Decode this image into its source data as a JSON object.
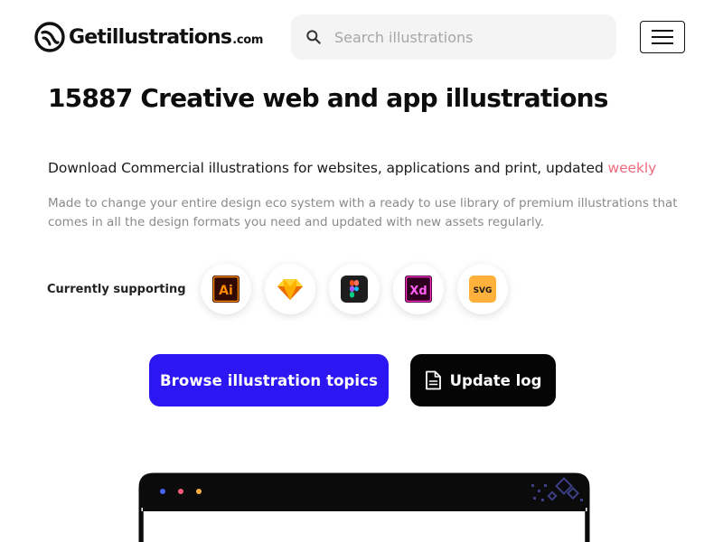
{
  "header": {
    "logo_text": "Getillustrations",
    "logo_suffix": ".com",
    "search_placeholder": "Search illustrations",
    "search_value": ""
  },
  "hero": {
    "title": "15887 Creative web and app illustrations",
    "subtitle": "Download Commercial illustrations for websites, applications and print, updated",
    "subtitle_accent": "weekly",
    "description": "Made to change your entire design eco system with a ready to use library of premium illustrations that comes in all the design formats you need and updated with new assets regularly.",
    "accent_color": "#f06a7e"
  },
  "support": {
    "label": "Currently supporting",
    "tools": [
      {
        "icon": "adobe-illustrator-icon",
        "text": "Ai"
      },
      {
        "icon": "sketch-icon",
        "text": ""
      },
      {
        "icon": "figma-icon",
        "text": ""
      },
      {
        "icon": "adobe-xd-icon",
        "text": "Xd"
      },
      {
        "icon": "svg-icon",
        "text": "SVG"
      }
    ]
  },
  "actions": {
    "browse_label": "Browse illustration topics",
    "browse_color": "#2c17f2",
    "update_log_label": "Update log",
    "update_log_color": "#050505"
  }
}
